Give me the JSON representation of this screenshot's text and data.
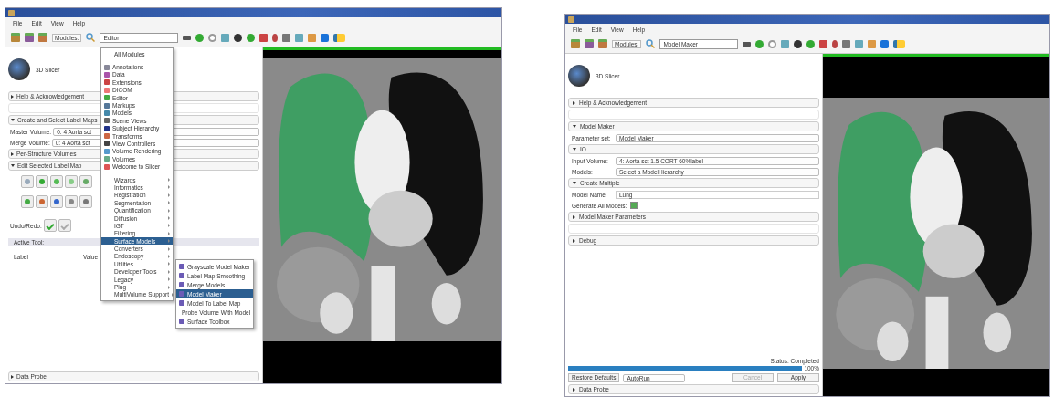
{
  "left_window": {
    "menu": [
      "File",
      "Edit",
      "View",
      "Help"
    ],
    "modules_label": "Modules:",
    "module_select": "Editor",
    "logo_text": "3D Slicer",
    "rows": [
      {
        "kind": "section",
        "label": "Help & Acknowledgement",
        "expanded": false
      },
      {
        "kind": "blank"
      },
      {
        "kind": "section",
        "label": "Create and Select Label Maps",
        "expanded": true
      },
      {
        "kind": "select",
        "label": "Master Volume:",
        "value": "0: 4 Aorta sct"
      },
      {
        "kind": "select",
        "label": "Merge Volume:",
        "value": "0: 4 Aorta sct"
      },
      {
        "kind": "section",
        "label": "Per-Structure Volumes",
        "expanded": false
      },
      {
        "kind": "section",
        "label": "Edit Selected Label Map",
        "expanded": true
      },
      {
        "kind": "tools"
      },
      {
        "kind": "tools"
      },
      {
        "kind": "undo",
        "label": "Undo/Redo:"
      },
      {
        "kind": "bar",
        "label": "Active Tool:"
      },
      {
        "kind": "pair",
        "labels": [
          "Label",
          "Value"
        ]
      },
      {
        "kind": "spacer"
      },
      {
        "kind": "section",
        "label": "Data Probe",
        "expanded": false
      }
    ],
    "module_menu": [
      {
        "kind": "header",
        "label": "All Modules",
        "selected": false
      },
      {
        "kind": "gap"
      },
      {
        "kind": "module",
        "label": "Annotations",
        "selected": false
      },
      {
        "kind": "module",
        "label": "Data",
        "selected": false
      },
      {
        "kind": "module",
        "label": "Extensions",
        "selected": false
      },
      {
        "kind": "module",
        "label": "DICOM",
        "selected": false
      },
      {
        "kind": "module",
        "label": "Editor",
        "selected": false
      },
      {
        "kind": "module",
        "label": "Markups",
        "selected": false
      },
      {
        "kind": "module",
        "label": "Models",
        "selected": false
      },
      {
        "kind": "module",
        "label": "Scene Views",
        "selected": false
      },
      {
        "kind": "module",
        "label": "Subject Hierarchy",
        "selected": false
      },
      {
        "kind": "module",
        "label": "Transforms",
        "selected": false
      },
      {
        "kind": "module",
        "label": "View Controllers",
        "selected": false
      },
      {
        "kind": "module",
        "label": "Volume Rendering",
        "selected": false
      },
      {
        "kind": "module",
        "label": "Volumes",
        "selected": false
      },
      {
        "kind": "module",
        "label": "Welcome to Slicer",
        "selected": false
      },
      {
        "kind": "gap"
      },
      {
        "kind": "category",
        "label": "Wizards",
        "selected": false
      },
      {
        "kind": "category",
        "label": "Informatics",
        "selected": false
      },
      {
        "kind": "category",
        "label": "Registration",
        "selected": false
      },
      {
        "kind": "category",
        "label": "Segmentation",
        "selected": false
      },
      {
        "kind": "category",
        "label": "Quantification",
        "selected": false
      },
      {
        "kind": "category",
        "label": "Diffusion",
        "selected": false
      },
      {
        "kind": "category",
        "label": "IGT",
        "selected": false
      },
      {
        "kind": "category",
        "label": "Filtering",
        "selected": false
      },
      {
        "kind": "category",
        "label": "Surface Models",
        "selected": true
      },
      {
        "kind": "category",
        "label": "Converters",
        "selected": false
      },
      {
        "kind": "category",
        "label": "Endoscopy",
        "selected": false
      },
      {
        "kind": "category",
        "label": "Utilities",
        "selected": false
      },
      {
        "kind": "category",
        "label": "Developer Tools",
        "selected": false
      },
      {
        "kind": "category",
        "label": "Legacy",
        "selected": false
      },
      {
        "kind": "category",
        "label": "Plug",
        "selected": false
      },
      {
        "kind": "category",
        "label": "MultiVolume Support",
        "selected": false
      }
    ],
    "submenu": [
      {
        "label": "Grayscale Model Maker",
        "selected": false
      },
      {
        "label": "Label Map Smoothing",
        "selected": false
      },
      {
        "label": "Merge Models",
        "selected": false
      },
      {
        "label": "Model Maker",
        "selected": true
      },
      {
        "label": "Model To Label Map",
        "selected": false
      },
      {
        "label": "Probe Volume With Model",
        "selected": false
      },
      {
        "label": "Surface Toolbox",
        "selected": false
      }
    ]
  },
  "right_window": {
    "menu": [
      "File",
      "Edit",
      "View",
      "Help"
    ],
    "modules_label": "Modules:",
    "module_select": "Model Maker",
    "logo_text": "3D Slicer",
    "rows": [
      {
        "kind": "section",
        "label": "Help & Acknowledgement",
        "expanded": false
      },
      {
        "kind": "blank"
      },
      {
        "kind": "section",
        "label": "Model Maker",
        "expanded": true
      },
      {
        "kind": "select",
        "label": "Parameter set:",
        "value": "Model Maker"
      },
      {
        "kind": "section",
        "label": "IO",
        "expanded": true
      },
      {
        "kind": "select",
        "label": "Input Volume:",
        "value": "4: Aorta sct 1.5 CORT 60%label"
      },
      {
        "kind": "select",
        "label": "Models:",
        "value": "Select a ModelHierarchy"
      },
      {
        "kind": "section",
        "label": "Create Multiple",
        "expanded": true
      },
      {
        "kind": "field",
        "label": "Model Name:",
        "value": "Lung"
      },
      {
        "kind": "check",
        "label": "Generate All Models:",
        "checked": true
      },
      {
        "kind": "section",
        "label": "Model Maker Parameters",
        "expanded": false
      },
      {
        "kind": "blank"
      },
      {
        "kind": "section",
        "label": "Debug",
        "expanded": false
      },
      {
        "kind": "spacer"
      },
      {
        "kind": "progress",
        "status": "Status: Completed",
        "level": 1,
        "reading": "100%"
      },
      {
        "kind": "buttons",
        "restore": "Restore Defaults",
        "run_mode": "AutoRun",
        "cancel": "Cancel",
        "cancel_disabled": true,
        "apply": "Apply"
      },
      {
        "kind": "section",
        "label": "Data Probe",
        "expanded": false
      }
    ]
  }
}
